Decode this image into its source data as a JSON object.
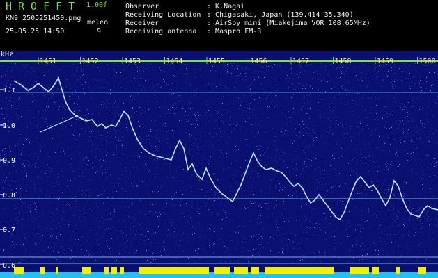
{
  "header": {
    "brand": "HROFFT",
    "version": "1.00f",
    "file_name": "KN9_2505251450.png",
    "meleo_label": "meleo",
    "meleo_value": "9",
    "datetime": "25.05.25 14:50",
    "info": [
      {
        "label": "Observer",
        "value": ": K.Nagai"
      },
      {
        "label": "Receiving Location",
        "value": ": Chigasaki, Japan (139.414 35.340)"
      },
      {
        "label": "Receiver",
        "value": ": AirSpy mini (Miakejima VOR 108.65MHz)"
      },
      {
        "label": "Receiving antenna",
        "value": ": Maspro FM-3"
      }
    ]
  },
  "spectrogram": {
    "y_unit": "kHz",
    "y_ticks": [
      "1.1",
      "1.0",
      "0.9",
      "0.8",
      "0.7",
      "0.6"
    ],
    "time_ticks": [
      "1451",
      "1452",
      "1453",
      "1454",
      "1455",
      "1456",
      "1457",
      "1458",
      "1459",
      "1500"
    ],
    "colors": {
      "background": "#0a1070",
      "noise": "#2f3fd0",
      "trace": "#b8e8ff",
      "axis": "#7ee05a",
      "signal_bar": "#f0f000",
      "baseline": "#25c0f0"
    }
  }
}
